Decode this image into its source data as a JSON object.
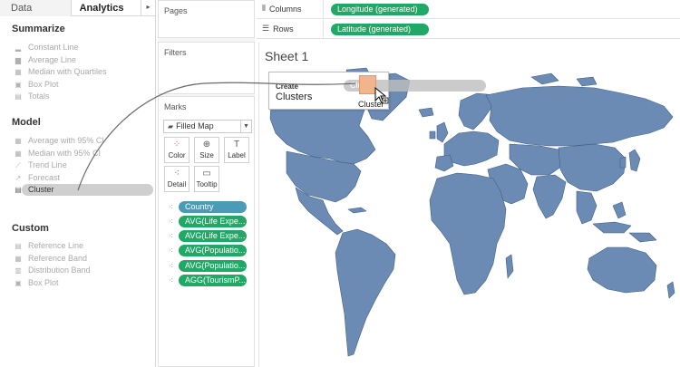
{
  "tabs": {
    "data": "Data",
    "analytics": "Analytics",
    "arrow": "▸"
  },
  "summarize": {
    "title": "Summarize",
    "items": [
      "Constant Line",
      "Average Line",
      "Median with Quartiles",
      "Box Plot",
      "Totals"
    ]
  },
  "model": {
    "title": "Model",
    "items": [
      "Average with 95% CI",
      "Median with 95% CI",
      "Trend Line",
      "Forecast",
      "Cluster"
    ]
  },
  "custom": {
    "title": "Custom",
    "items": [
      "Reference Line",
      "Reference Band",
      "Distribution Band",
      "Box Plot"
    ]
  },
  "panels": {
    "pages": "Pages",
    "filters": "Filters",
    "marks": "Marks"
  },
  "marks": {
    "type": "Filled Map",
    "buttons": [
      "Color",
      "Size",
      "Label",
      "Detail",
      "Tooltip"
    ],
    "pills": [
      "Country",
      "AVG(Life Expe...",
      "AVG(Life Expe...",
      "AVG(Populatio...",
      "AVG(Populatio...",
      "AGG(TourismP..."
    ]
  },
  "shelves": {
    "columns_label": "Columns",
    "columns_value": "Longitude (generated)",
    "rows_label": "Rows",
    "rows_value": "Latitude (generated)"
  },
  "sheet": {
    "title": "Sheet 1"
  },
  "popup": {
    "create": "Create",
    "clusters": "Clusters",
    "drag_label": "Cluster",
    "drop_label": "Cluster"
  },
  "colors": {
    "map_fill": "#6b8bb4",
    "map_stroke": "#3f5f86",
    "green_pill": "#1fa866",
    "blue_pill": "#4a9bb5"
  }
}
